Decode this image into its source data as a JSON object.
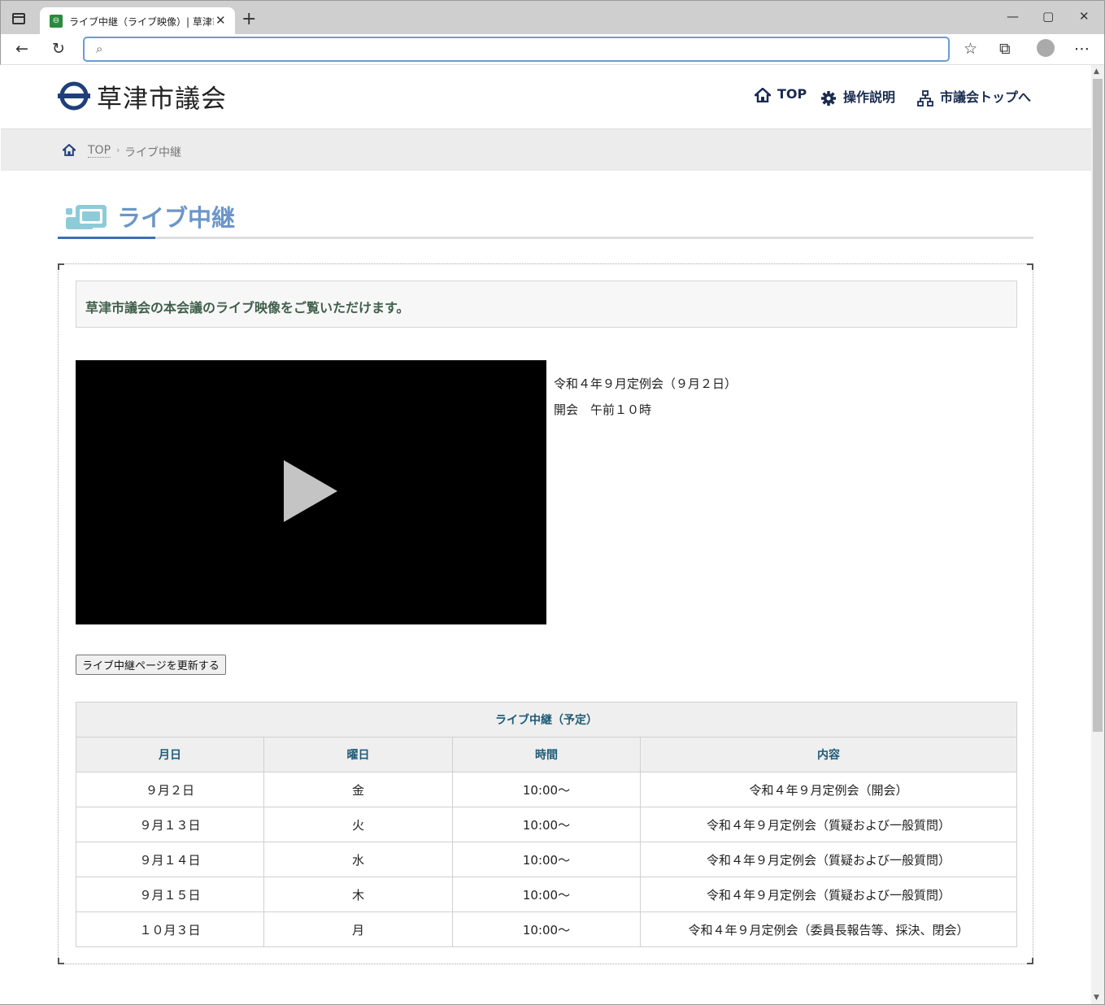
{
  "browser": {
    "tab_title": "ライブ中継（ライブ映像）| 草津市議会",
    "favicon_glyph": "⊖",
    "new_tab": "+",
    "close_tab": "✕",
    "minimize": "—",
    "maximize": "▢",
    "close_window": "✕",
    "address_value": "",
    "back": "←",
    "reload": "↻",
    "favorites": "☆",
    "collections": "⧉",
    "more": "⋯"
  },
  "site": {
    "name": "草津市議会",
    "nav": [
      {
        "label": "TOP",
        "icon": "home-icon"
      },
      {
        "label": "操作説明",
        "icon": "gear-icon"
      },
      {
        "label": "市議会トップへ",
        "icon": "sitemap-icon"
      }
    ]
  },
  "breadcrumb": {
    "home": "TOP",
    "separator": "›",
    "current": "ライブ中継"
  },
  "page": {
    "title": "ライブ中継",
    "lead": "草津市議会の本会議のライブ映像をご覧いただけます。",
    "video_info": [
      "令和４年９月定例会（９月２日）",
      "開会　午前１０時"
    ],
    "refresh_button": "ライブ中継ページを更新する"
  },
  "schedule": {
    "caption": "ライブ中継（予定）",
    "columns": [
      "月日",
      "曜日",
      "時間",
      "内容"
    ],
    "rows": [
      [
        "９月２日",
        "金",
        "10:00～",
        "令和４年９月定例会（開会）"
      ],
      [
        "９月１３日",
        "火",
        "10:00～",
        "令和４年９月定例会（質疑および一般質問）"
      ],
      [
        "９月１４日",
        "水",
        "10:00～",
        "令和４年９月定例会（質疑および一般質問）"
      ],
      [
        "９月１５日",
        "木",
        "10:00～",
        "令和４年９月定例会（質疑および一般質問）"
      ],
      [
        "１０月３日",
        "月",
        "10:00～",
        "令和４年９月定例会（委員長報告等、採決、閉会）"
      ]
    ]
  },
  "colors": {
    "accent": "#3b6fb6",
    "title": "#6a96c8",
    "nav_text": "#1a2b50",
    "table_header": "#205b78",
    "lead_text": "#3f5f4a"
  }
}
